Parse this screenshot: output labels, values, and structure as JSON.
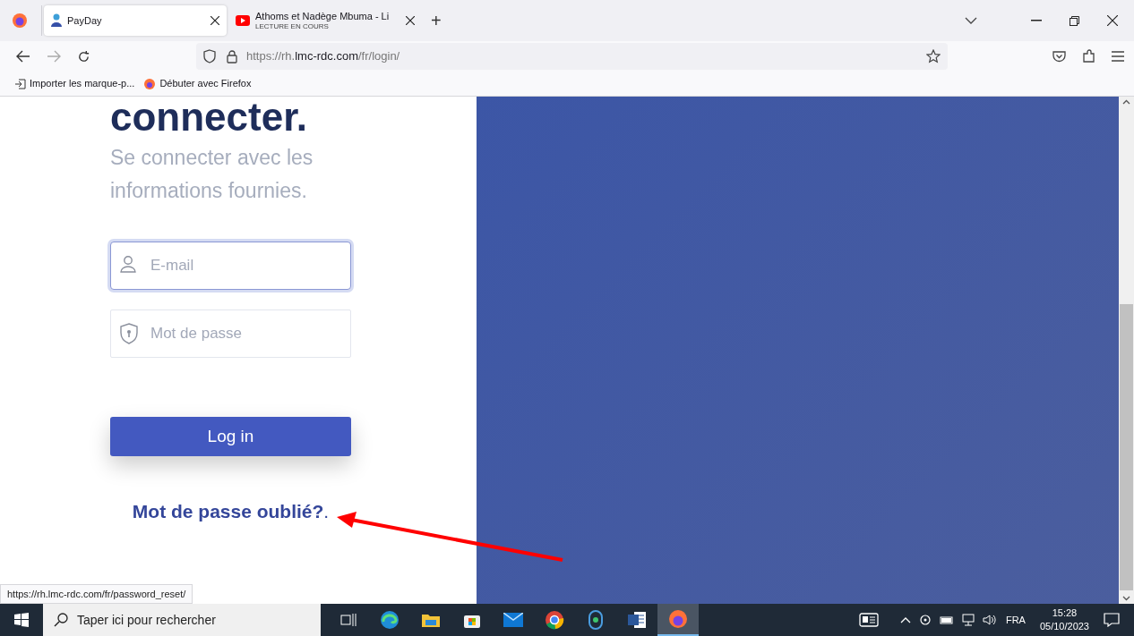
{
  "browser": {
    "tabs": [
      {
        "kind": "page",
        "title": "PayDay",
        "selected": true
      },
      {
        "kind": "media",
        "title": "Athoms et Nadège Mbuma - Li",
        "subtitle": "LECTURE EN COURS",
        "selected": false
      }
    ],
    "new_tab": "+",
    "address": {
      "scheme": "https://rh.",
      "domain": "lmc-rdc.com",
      "path": "/fr/login/"
    },
    "bookmarks": [
      {
        "kind": "import",
        "label": "Importer les marque-p..."
      },
      {
        "kind": "firefox",
        "label": "Débuter avec Firefox"
      }
    ]
  },
  "login": {
    "heading": "connecter.",
    "subtitle": "Se connecter avec les informations fournies.",
    "email": {
      "placeholder": "E-mail",
      "focused": true
    },
    "password": {
      "placeholder": "Mot de passe",
      "focused": false
    },
    "button": "Log in",
    "forgot_link": "Mot de passe oublié?",
    "forgot_suffix": "."
  },
  "status_url": "https://rh.lmc-rdc.com/fr/password_reset/",
  "taskbar": {
    "search_placeholder": "Taper ici pour rechercher",
    "apps": [
      {
        "kind": "taskview",
        "active": false
      },
      {
        "kind": "edge",
        "active": false
      },
      {
        "kind": "explorer",
        "active": false
      },
      {
        "kind": "store",
        "active": false
      },
      {
        "kind": "mail",
        "active": false
      },
      {
        "kind": "chrome",
        "active": false
      },
      {
        "kind": "vpn",
        "active": false
      },
      {
        "kind": "word",
        "active": false
      },
      {
        "kind": "firefox",
        "active": true
      }
    ],
    "language": "FRA",
    "time": "15:28",
    "date": "05/10/2023"
  }
}
